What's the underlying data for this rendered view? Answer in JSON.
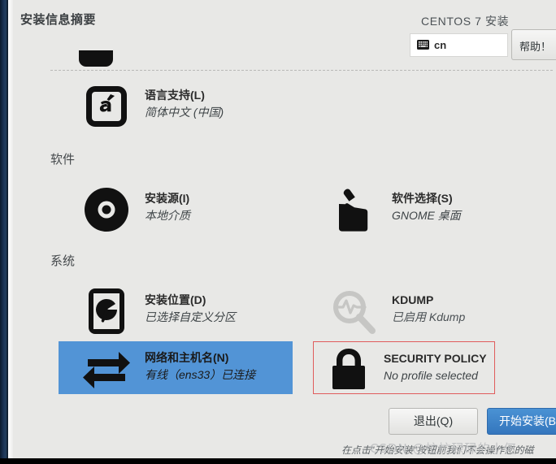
{
  "header": {
    "title": "安装信息摘要",
    "brand": "CENTOS 7 安装",
    "keyboard_layout": "cn",
    "keyboard_icon": "keyboard-icon",
    "help_label": "帮助！"
  },
  "sections": [
    {
      "id": "localization-partial",
      "label": "",
      "items": [
        {
          "id": "language-support",
          "icon": "language-support-icon",
          "title": "语言支持(L)",
          "status": "简体中文 (中国)",
          "state": "normal"
        }
      ]
    },
    {
      "id": "software",
      "label": "软件",
      "items": [
        {
          "id": "installation-source",
          "icon": "optical-disc-icon",
          "title": "安装源(I)",
          "status": "本地介质",
          "state": "normal"
        },
        {
          "id": "software-selection",
          "icon": "software-package-icon",
          "title": "软件选择(S)",
          "status": "GNOME 桌面",
          "state": "normal"
        }
      ]
    },
    {
      "id": "system",
      "label": "系统",
      "items": [
        {
          "id": "installation-destination",
          "icon": "hard-drive-icon",
          "title": "安装位置(D)",
          "status": "已选择自定义分区",
          "state": "normal"
        },
        {
          "id": "kdump",
          "icon": "magnifier-waveform-icon",
          "title": "KDUMP",
          "status": "已启用 Kdump",
          "state": "disabled"
        },
        {
          "id": "network-hostname",
          "icon": "network-arrows-icon",
          "title": "网络和主机名(N)",
          "status": "有线（ens33）已连接",
          "state": "selected"
        },
        {
          "id": "security-policy",
          "icon": "lock-icon",
          "title": "SECURITY POLICY",
          "status": "No profile selected",
          "state": "highlighted"
        }
      ]
    }
  ],
  "footer": {
    "quit_label": "退出(Q)",
    "begin_label": "开始安装(B",
    "note": "在点击\"开始安装\"按钮前我们不会操作您的磁",
    "watermark": "CSDN @忙忙碌碌的小何"
  },
  "colors": {
    "accent_blue": "#5294d6",
    "primary_button": "#3f87cd",
    "highlight_red": "#e05c5c",
    "background": "#e8e8e6",
    "edge_bar": "#1d3557"
  }
}
